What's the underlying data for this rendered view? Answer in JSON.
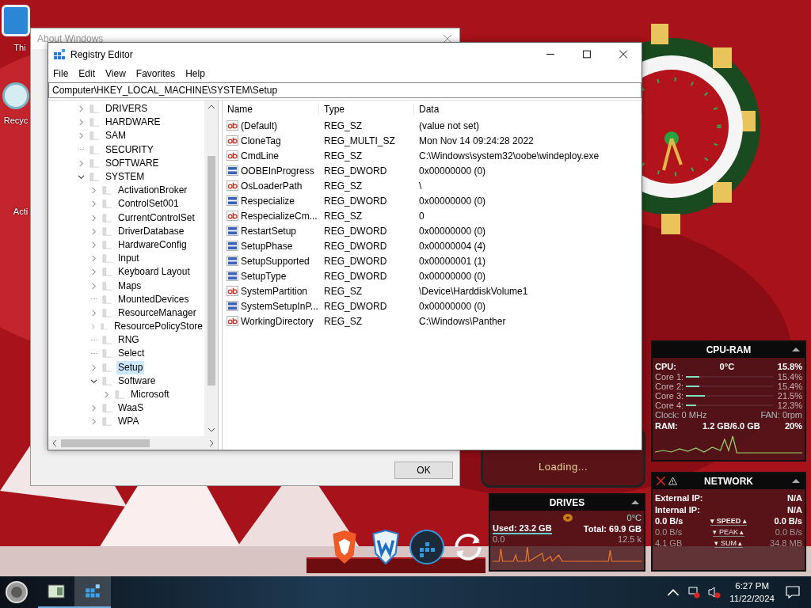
{
  "desktop_icons": [
    {
      "label": "Thi"
    },
    {
      "label": "Recyc"
    },
    {
      "label": "Acti"
    }
  ],
  "about_window": {
    "title": "About Windows",
    "ok_button": "OK"
  },
  "loading_gadget": {
    "text": "Loading..."
  },
  "registry_editor": {
    "title": "Registry Editor",
    "menu": [
      "File",
      "Edit",
      "View",
      "Favorites",
      "Help"
    ],
    "address": "Computer\\HKEY_LOCAL_MACHINE\\SYSTEM\\Setup",
    "tree": [
      {
        "label": "DRIVERS",
        "expandable": true,
        "expanded": false,
        "selected": false
      },
      {
        "label": "HARDWARE",
        "expandable": true,
        "expanded": false,
        "selected": false
      },
      {
        "label": "SAM",
        "expandable": true,
        "expanded": false,
        "selected": false
      },
      {
        "label": "SECURITY",
        "expandable": false,
        "selected": false
      },
      {
        "label": "SOFTWARE",
        "expandable": true,
        "expanded": false,
        "selected": false
      },
      {
        "label": "SYSTEM",
        "expandable": true,
        "expanded": true,
        "selected": false,
        "children": [
          {
            "label": "ActivationBroker",
            "expandable": true,
            "expanded": false,
            "selected": false
          },
          {
            "label": "ControlSet001",
            "expandable": true,
            "expanded": false,
            "selected": false
          },
          {
            "label": "CurrentControlSet",
            "expandable": true,
            "expanded": false,
            "selected": false
          },
          {
            "label": "DriverDatabase",
            "expandable": true,
            "expanded": false,
            "selected": false
          },
          {
            "label": "HardwareConfig",
            "expandable": true,
            "expanded": false,
            "selected": false
          },
          {
            "label": "Input",
            "expandable": true,
            "expanded": false,
            "selected": false
          },
          {
            "label": "Keyboard Layout",
            "expandable": true,
            "expanded": false,
            "selected": false
          },
          {
            "label": "Maps",
            "expandable": true,
            "expanded": false,
            "selected": false
          },
          {
            "label": "MountedDevices",
            "expandable": false,
            "selected": false
          },
          {
            "label": "ResourceManager",
            "expandable": true,
            "expanded": false,
            "selected": false
          },
          {
            "label": "ResourcePolicyStore",
            "expandable": true,
            "expanded": false,
            "selected": false
          },
          {
            "label": "RNG",
            "expandable": false,
            "selected": false
          },
          {
            "label": "Select",
            "expandable": false,
            "selected": false
          },
          {
            "label": "Setup",
            "expandable": true,
            "expanded": false,
            "selected": true
          },
          {
            "label": "Software",
            "expandable": true,
            "expanded": true,
            "selected": false,
            "children": [
              {
                "label": "Microsoft",
                "expandable": true,
                "expanded": false,
                "selected": false
              }
            ]
          },
          {
            "label": "WaaS",
            "expandable": true,
            "expanded": false,
            "selected": false
          },
          {
            "label": "WPA",
            "expandable": true,
            "expanded": false,
            "selected": false
          }
        ]
      }
    ],
    "columns": [
      "Name",
      "Type",
      "Data"
    ],
    "values": [
      {
        "kind": "string",
        "name": "(Default)",
        "type": "REG_SZ",
        "data": "(value not set)"
      },
      {
        "kind": "string",
        "name": "CloneTag",
        "type": "REG_MULTI_SZ",
        "data": "Mon Nov 14 09:24:28 2022"
      },
      {
        "kind": "string",
        "name": "CmdLine",
        "type": "REG_SZ",
        "data": "C:\\Windows\\system32\\oobe\\windeploy.exe"
      },
      {
        "kind": "dword",
        "name": "OOBEInProgress",
        "type": "REG_DWORD",
        "data": "0x00000000 (0)"
      },
      {
        "kind": "string",
        "name": "OsLoaderPath",
        "type": "REG_SZ",
        "data": "\\"
      },
      {
        "kind": "dword",
        "name": "Respecialize",
        "type": "REG_DWORD",
        "data": "0x00000000 (0)"
      },
      {
        "kind": "string",
        "name": "RespecializeCm...",
        "type": "REG_SZ",
        "data": "0"
      },
      {
        "kind": "dword",
        "name": "RestartSetup",
        "type": "REG_DWORD",
        "data": "0x00000000 (0)"
      },
      {
        "kind": "dword",
        "name": "SetupPhase",
        "type": "REG_DWORD",
        "data": "0x00000004 (4)"
      },
      {
        "kind": "dword",
        "name": "SetupSupported",
        "type": "REG_DWORD",
        "data": "0x00000001 (1)"
      },
      {
        "kind": "dword",
        "name": "SetupType",
        "type": "REG_DWORD",
        "data": "0x00000000 (0)"
      },
      {
        "kind": "string",
        "name": "SystemPartition",
        "type": "REG_SZ",
        "data": "\\Device\\HarddiskVolume1"
      },
      {
        "kind": "dword",
        "name": "SystemSetupInP...",
        "type": "REG_DWORD",
        "data": "0x00000000 (0)"
      },
      {
        "kind": "string",
        "name": "WorkingDirectory",
        "type": "REG_SZ",
        "data": "C:\\Windows\\Panther"
      }
    ]
  },
  "cpu_ram": {
    "title": "CPU-RAM",
    "cpu_label": "CPU:",
    "temp": "0°C",
    "total": "15.8%",
    "cores": [
      {
        "name": "Core 1:",
        "value": "15.4%",
        "level": 0.154
      },
      {
        "name": "Core 2:",
        "value": "15.4%",
        "level": 0.154
      },
      {
        "name": "Core 3:",
        "value": "21.5%",
        "level": 0.215
      },
      {
        "name": "Core 4:",
        "value": "12.3%",
        "level": 0.123
      }
    ],
    "clock": "Clock: 0 MHz",
    "fan": "FAN: 0rpm",
    "ram_label": "RAM:",
    "ram_used": "1.2 GB/6.0 GB",
    "ram_percent": "20%"
  },
  "network": {
    "title": "NETWORK",
    "rows": [
      {
        "label": "External IP:",
        "value": "N/A"
      },
      {
        "label": "Internal IP:",
        "value": "N/A"
      }
    ],
    "stats": [
      {
        "left": "0.0 B/s",
        "label": "▾ SPEED ▴",
        "right": "0.0 B/s",
        "dim": false
      },
      {
        "left": "0.0 B/s",
        "label": "▾ PEAK ▴",
        "right": "0.0 B/s",
        "dim": true
      },
      {
        "left": "4.1 GB",
        "label": "▾ SUM ▴",
        "right": "34.8 MB",
        "dim": true
      }
    ]
  },
  "drives": {
    "title": "DRIVES",
    "temp": "0°C",
    "used": "Used: 23.2 GB",
    "total": "Total: 69.9 GB",
    "read": "0.0",
    "write": "12.5 k"
  },
  "taskbar": {
    "time": "6:27 PM",
    "date": "11/22/2024"
  }
}
